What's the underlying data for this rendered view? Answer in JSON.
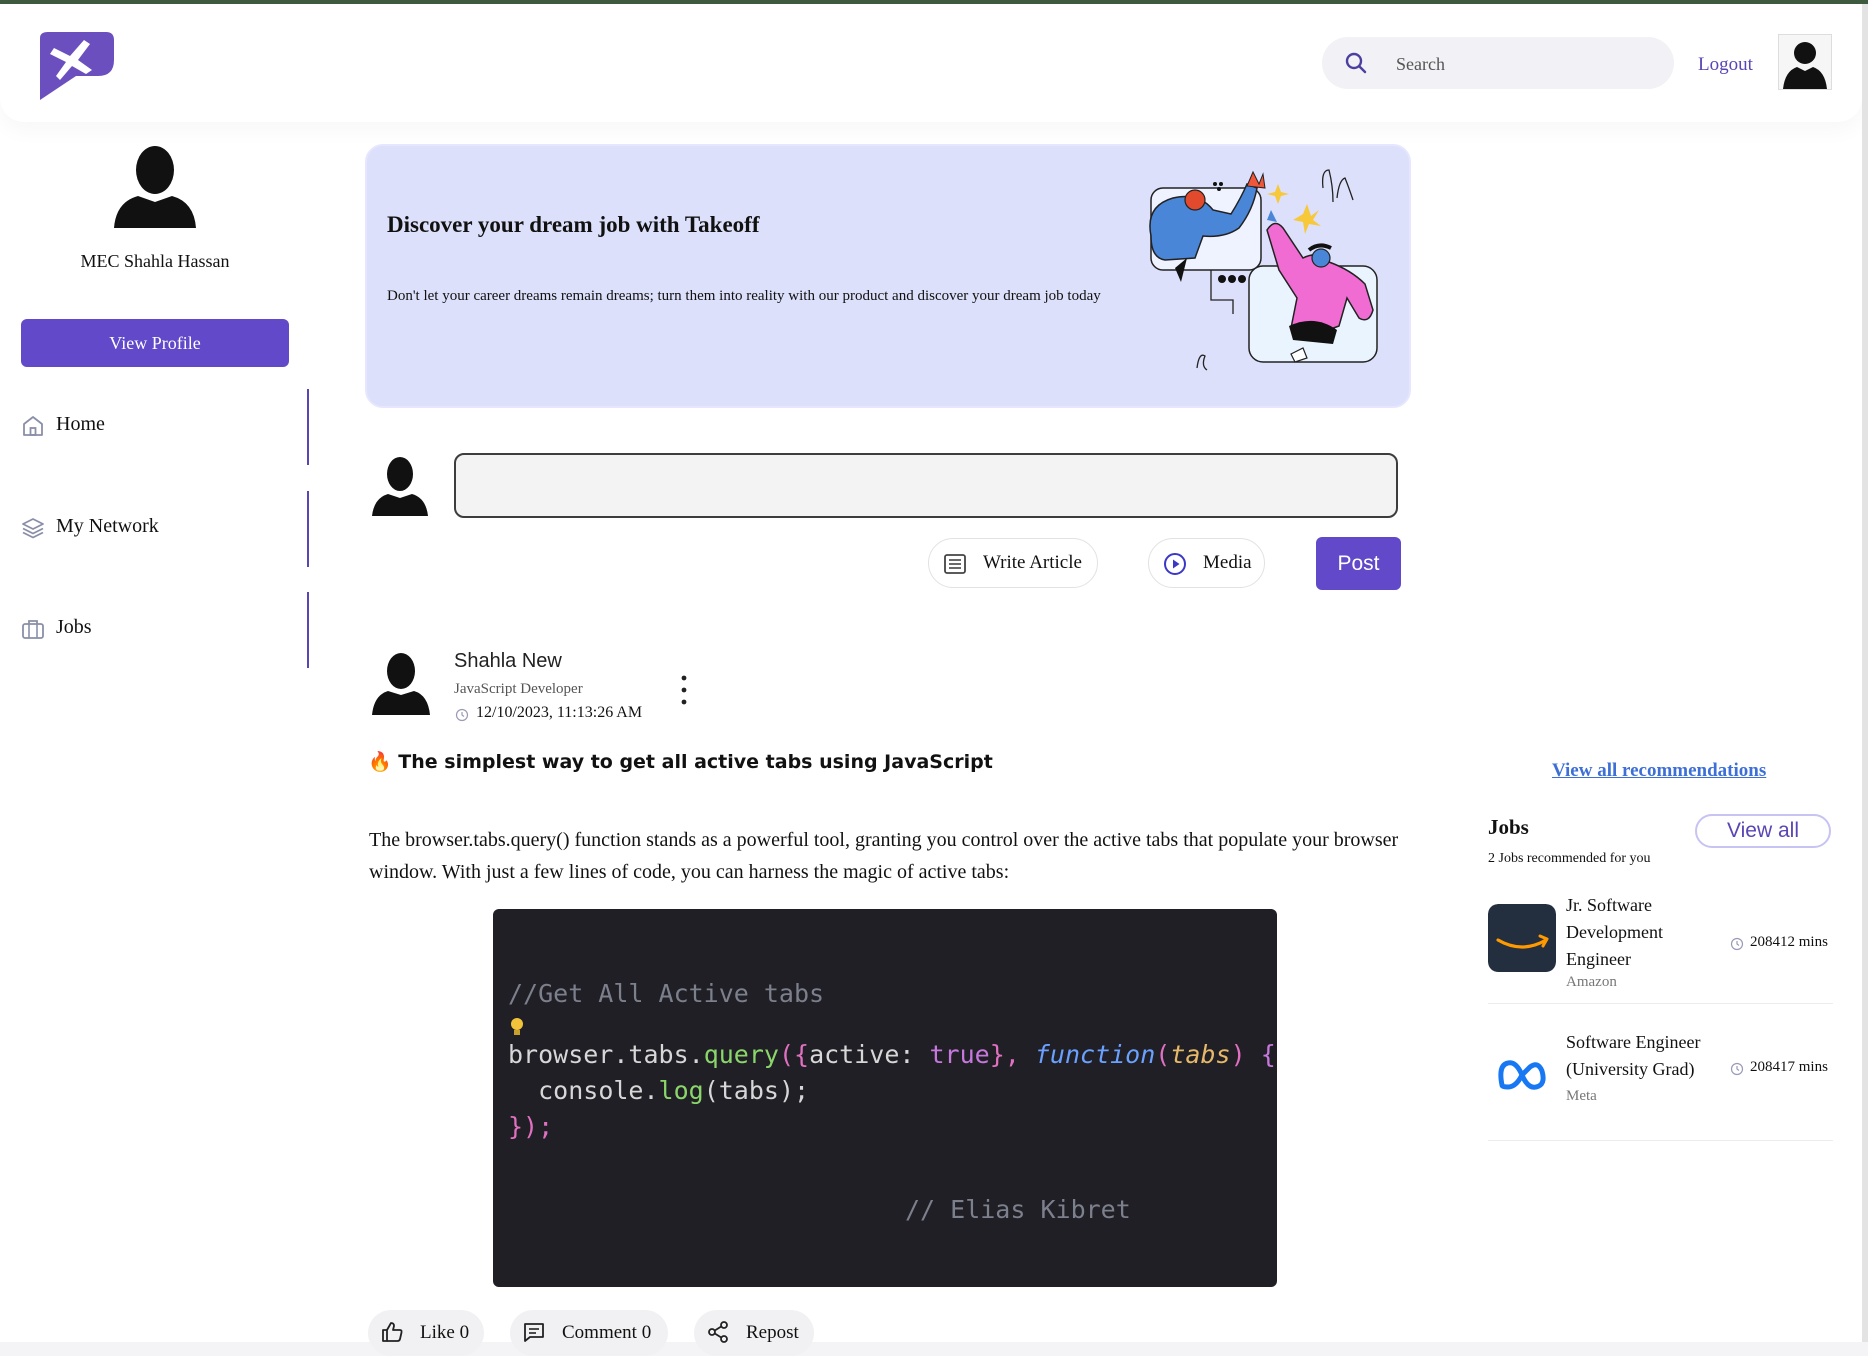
{
  "header": {
    "search_placeholder": "Search",
    "logout_label": "Logout"
  },
  "sidebar": {
    "user_name": "MEC Shahla Hassan",
    "view_profile_label": "View Profile",
    "nav": [
      {
        "label": "Home",
        "icon": "home-icon"
      },
      {
        "label": "My Network",
        "icon": "layers-icon"
      },
      {
        "label": "Jobs",
        "icon": "briefcase-icon"
      }
    ]
  },
  "banner": {
    "title": "Discover your dream job with Takeoff",
    "text": "Don't let your career dreams remain dreams; turn them into reality with our product and discover your dream job today"
  },
  "composer": {
    "write_article_label": "Write Article",
    "media_label": "Media",
    "post_label": "Post"
  },
  "post": {
    "author": "Shahla New",
    "role": "JavaScript Developer",
    "timestamp": "12/10/2023, 11:13:26 AM",
    "title_emoji": "🔥",
    "title": "The simplest way to get all active tabs using JavaScript",
    "body": "The browser.tabs.query() function stands as a powerful tool, granting you control over the active tabs that populate your browser window. With just a few lines of code, you can harness the magic of active tabs:",
    "code": {
      "comment": "//Get All Active tabs",
      "line1_obj": "browser",
      "line1_dot1": ".",
      "line1_prop": "tabs",
      "line1_dot2": ".",
      "line1_method": "query",
      "line1_open": "({",
      "line1_key": "active: ",
      "line1_true": "true",
      "line1_close": "}, ",
      "line1_function": "function",
      "line1_param_open": "(",
      "line1_param": "tabs",
      "line1_param_close": ") ",
      "line1_brace": "{",
      "line2_indent": "  ",
      "line2_obj": "console",
      "line2_dot": ".",
      "line2_method": "log",
      "line2_args": "(tabs);",
      "line3": "});",
      "signature": "// Elias Kibret"
    },
    "actions": {
      "like_label": "Like 0",
      "comment_label": "Comment 0",
      "repost_label": "Repost"
    }
  },
  "right": {
    "recommendations_link": "View all recommendations",
    "jobs_title": "Jobs",
    "jobs_subtitle": "2 Jobs recommended for you",
    "view_all_label": "View all",
    "jobs": [
      {
        "title": "Jr. Software Development Engineer",
        "company": "Amazon",
        "mins": "208412 mins"
      },
      {
        "title": "Software Engineer (University Grad)",
        "company": "Meta",
        "mins": "208417 mins"
      }
    ]
  },
  "colors": {
    "accent": "#6149c9",
    "banner_bg": "#dde0fb",
    "code_bg": "#1f1f25"
  }
}
